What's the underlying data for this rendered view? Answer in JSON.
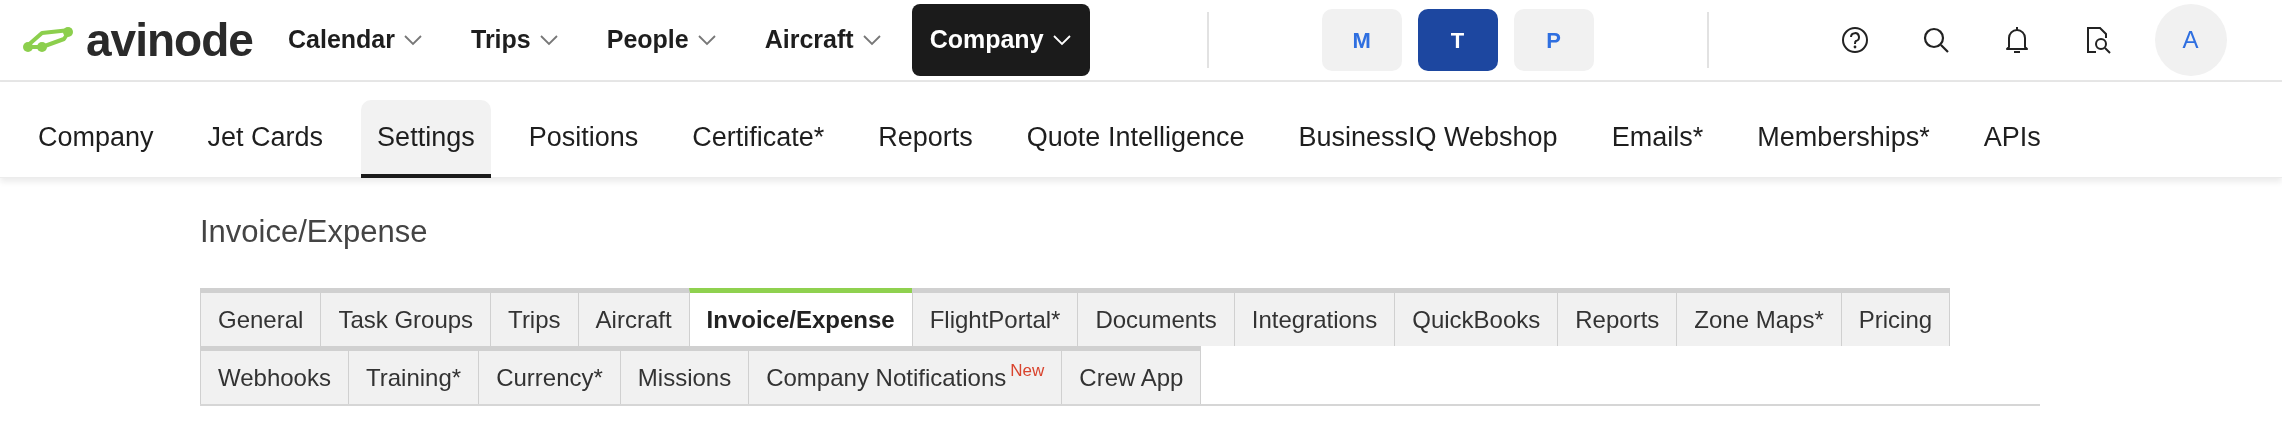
{
  "logo": {
    "text": "avinode"
  },
  "main_nav": [
    {
      "label": "Calendar",
      "selected": false
    },
    {
      "label": "Trips",
      "selected": false
    },
    {
      "label": "People",
      "selected": false
    },
    {
      "label": "Aircraft",
      "selected": false
    },
    {
      "label": "Company",
      "selected": true
    }
  ],
  "mode_buttons": [
    {
      "label": "M",
      "selected": false
    },
    {
      "label": "T",
      "selected": true
    },
    {
      "label": "P",
      "selected": false
    }
  ],
  "avatar": {
    "initial": "A"
  },
  "sub_nav": [
    {
      "label": "Company",
      "selected": false
    },
    {
      "label": "Jet Cards",
      "selected": false
    },
    {
      "label": "Settings",
      "selected": true
    },
    {
      "label": "Positions",
      "selected": false
    },
    {
      "label": "Certificate*",
      "selected": false
    },
    {
      "label": "Reports",
      "selected": false
    },
    {
      "label": "Quote Intelligence",
      "selected": false
    },
    {
      "label": "BusinessIQ Webshop",
      "selected": false
    },
    {
      "label": "Emails*",
      "selected": false
    },
    {
      "label": "Memberships*",
      "selected": false
    },
    {
      "label": "APIs",
      "selected": false
    }
  ],
  "page_title": "Invoice/Expense",
  "settings_tabs": [
    {
      "label": "General",
      "selected": false
    },
    {
      "label": "Task Groups",
      "selected": false
    },
    {
      "label": "Trips",
      "selected": false
    },
    {
      "label": "Aircraft",
      "selected": false
    },
    {
      "label": "Invoice/Expense",
      "selected": true
    },
    {
      "label": "FlightPortal*",
      "selected": false
    },
    {
      "label": "Documents",
      "selected": false
    },
    {
      "label": "Integrations",
      "selected": false
    },
    {
      "label": "QuickBooks",
      "selected": false
    },
    {
      "label": "Reports",
      "selected": false
    },
    {
      "label": "Zone Maps*",
      "selected": false
    },
    {
      "label": "Pricing",
      "selected": false
    },
    {
      "label": "Webhooks",
      "selected": false
    },
    {
      "label": "Training*",
      "selected": false
    },
    {
      "label": "Currency*",
      "selected": false
    },
    {
      "label": "Missions",
      "selected": false
    },
    {
      "label": "Company Notifications",
      "selected": false,
      "badge": "New"
    },
    {
      "label": "Crew App",
      "selected": false
    }
  ]
}
